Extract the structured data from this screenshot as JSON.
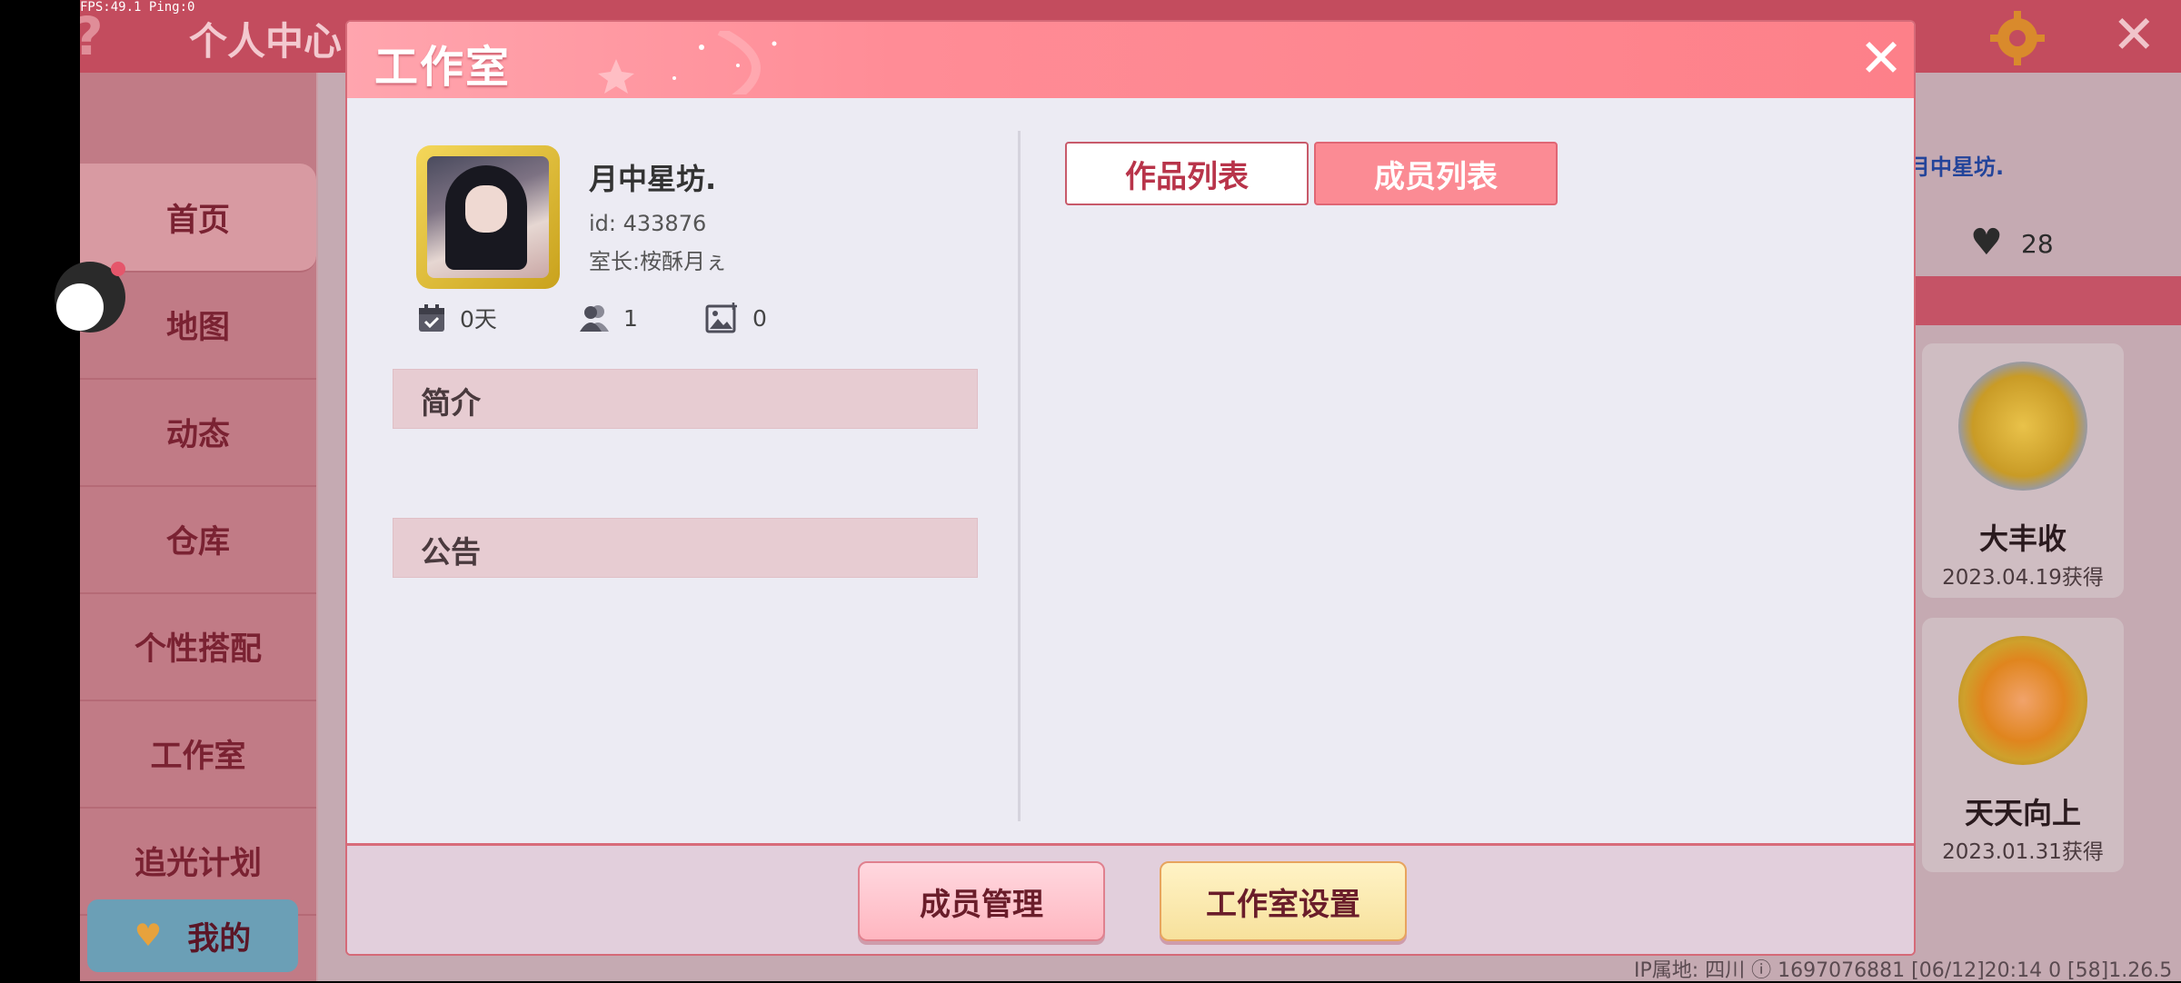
{
  "overlay": {
    "fps": "FPS:49.1  Ping:0"
  },
  "background": {
    "title": "个人中心",
    "help_icon": "question-icon",
    "gear_icon": "gear-icon",
    "close_icon": "close-icon",
    "nav": [
      "首页",
      "地图",
      "动态",
      "仓库",
      "个性搭配",
      "工作室",
      "追光计划"
    ],
    "mine_label": "我的",
    "right_name": "月中星坊.",
    "likes": "28",
    "cards": [
      {
        "title": "大丰收",
        "date": "2023.04.19获得"
      },
      {
        "title": "天天向上",
        "date": "2023.01.31获得"
      }
    ],
    "status_line": "IP属地: 四川 ⓘ     1697076881   [06/12]20:14 0   [58]1.26.5"
  },
  "dialog": {
    "title": "工作室",
    "close_label": "✕",
    "studio": {
      "name": "月中星坊.",
      "id": "id: 433876",
      "owner": "室长:桉酥月ぇ",
      "stats": {
        "days": "0天",
        "members": "1",
        "works": "0"
      }
    },
    "sections": {
      "intro": "简介",
      "notice": "公告"
    },
    "tabs": {
      "works": "作品列表",
      "members": "成员列表"
    },
    "buttons": {
      "member_manage": "成员管理",
      "studio_settings": "工作室设置"
    }
  },
  "colors": {
    "accent": "#fb8b94",
    "header": "#ff8c96",
    "section": "#e7ccd2"
  }
}
